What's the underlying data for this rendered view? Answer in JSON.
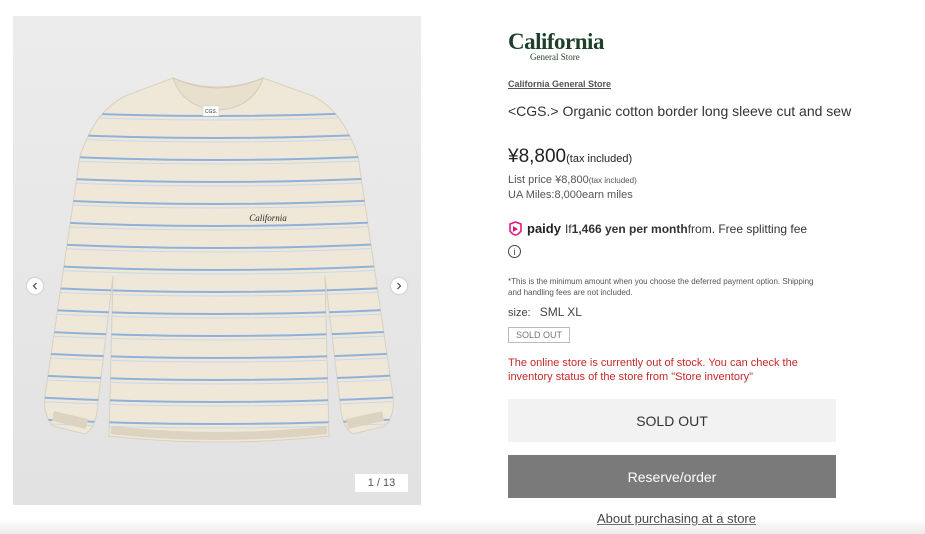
{
  "gallery": {
    "counter": "1 / 13",
    "prev_icon": "chevron-left-icon",
    "next_icon": "chevron-right-icon",
    "shirt_tag": "CGS.",
    "shirt_print": "California"
  },
  "brand": {
    "logo_main": "California",
    "logo_sub": "General Store",
    "link": "California General Store"
  },
  "product": {
    "title": "<CGS.> Organic cotton border long sleeve cut and sew",
    "price": "¥8,800",
    "price_tax": "(tax included)",
    "list_price_label": "List price ¥8,800",
    "list_price_tax": "(tax included)",
    "miles": "UA Miles:8,000earn miles"
  },
  "payment": {
    "paidy_label": "paidy",
    "prefix": "If",
    "amount": "1,466 yen per month",
    "suffix": "from. Free splitting fee",
    "note": "*This is the minimum amount when you choose the deferred payment option. Shipping and handling fees are not included."
  },
  "size": {
    "label": "size:",
    "values": "SML XL"
  },
  "stock": {
    "badge": "SOLD OUT",
    "message": "The online store is currently out of stock. You can check the inventory status of the store from \"Store inventory\""
  },
  "actions": {
    "sold_out": "SOLD OUT",
    "reserve": "Reserve/order",
    "store_link": "About purchasing at a store"
  },
  "colors": {
    "accent_red": "#c62828",
    "brand_green": "#1f3f2b",
    "paidy_pink": "#e0197d",
    "reserve_bg": "#7a7a7a"
  }
}
